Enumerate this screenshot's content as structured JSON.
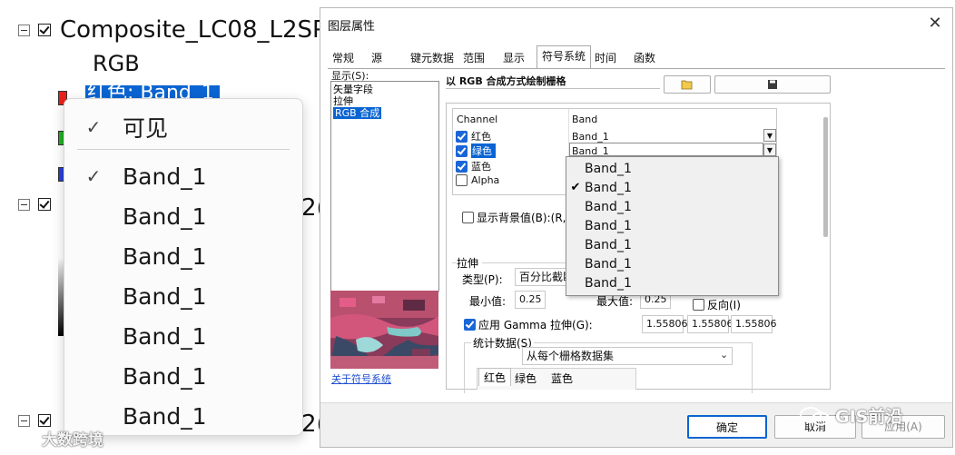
{
  "toc": {
    "composite_layer": "Composite_LC08_L2SP",
    "rgb_label": "RGB",
    "red_row_label": "红色:   Band_1",
    "partial_suffix": "2("
  },
  "left_menu": {
    "visible_label": "可见",
    "band_items": [
      "Band_1",
      "Band_1",
      "Band_1",
      "Band_1",
      "Band_1",
      "Band_1",
      "Band_1"
    ],
    "checked_index": 0
  },
  "dialog": {
    "title": "图层属性",
    "tabs": [
      "常规",
      "源",
      "键元数据",
      "范围",
      "显示",
      "符号系统",
      "时间",
      "函数"
    ],
    "active_tab": "符号系统",
    "show_label": "显示(S):",
    "show_items": [
      "矢量字段",
      "拉伸",
      "RGB 合成"
    ],
    "selected_show": "RGB 合成",
    "heading": "以 RGB 合成方式绘制栅格",
    "open_icon": "folder-icon",
    "save_icon": "floppy-icon",
    "channel_header": "Channel",
    "band_header": "Band",
    "channels": [
      {
        "name": "红色",
        "band": "Band_1",
        "checked": true
      },
      {
        "name": "绿色",
        "band": "Band_1",
        "checked": true
      },
      {
        "name": "蓝色",
        "band": "",
        "checked": true
      },
      {
        "name": "Alpha",
        "band": "",
        "checked": false
      }
    ],
    "show_background": "显示背景值(B):(R, G",
    "stretch_group": "拉伸",
    "type_label": "类型(P):",
    "type_value": "百分比截断",
    "min_label": "最小值:",
    "min_value": "0.25",
    "max_label": "最大值:",
    "max_value": "0.25",
    "invert_label": "反向(I)",
    "gamma_label": "应用 Gamma 拉伸(G):",
    "gamma_values": [
      "1.55806",
      "1.55806",
      "1.55806"
    ],
    "stats_group": "统计数据(S)",
    "stats_value": "从每个栅格数据集",
    "bottom_tabs": [
      "红色",
      "绿色",
      "蓝色"
    ],
    "about_link": "关于符号系统",
    "ok_button": "确定",
    "cancel_button": "取消",
    "apply_button": "应用(A)",
    "close_icon": "close-icon"
  },
  "dropdown": {
    "items": [
      "Band_1",
      "Band_1",
      "Band_1",
      "Band_1",
      "Band_1",
      "Band_1",
      "Band_1"
    ],
    "checked_index": 1
  },
  "watermarks": {
    "left": "大数跨境",
    "right": "GIS前沿"
  },
  "colors": {
    "selection_blue": "#0a64d2",
    "checkbox_blue": "#1a66d6",
    "swatch_red": "#e8201c",
    "swatch_green": "#21b026",
    "swatch_blue": "#2a3fd8"
  }
}
